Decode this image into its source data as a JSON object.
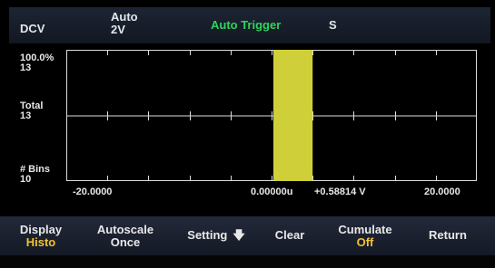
{
  "status": {
    "mode": "DCV",
    "range_top": "Auto",
    "range_bottom": "2V",
    "trigger": "Auto Trigger",
    "s_indicator": "S"
  },
  "left_labels": {
    "top_pct": "100.0%",
    "top_count": "13",
    "total_label": "Total",
    "total_value": "13",
    "bins_label": "# Bins",
    "bins_value": "10"
  },
  "x_labels": {
    "left": "-20.0000",
    "mid": "0.00000u",
    "value": "+0.58814 V",
    "right": "20.0000"
  },
  "chart_data": {
    "type": "bar",
    "xlim": [
      -20.0,
      20.0
    ],
    "bin_count": 10,
    "total_count": 13,
    "bars": [
      {
        "x_start": 0.0,
        "x_end": 4.0,
        "count": 13,
        "percent": 100.0
      }
    ],
    "bar_color": "#cfcf3a"
  },
  "softkeys": {
    "display": {
      "label": "Display",
      "value": "Histo"
    },
    "autoscale": {
      "label": "Autoscale",
      "value": "Once"
    },
    "setting": {
      "label": "Setting",
      "icon": "arrow-down-icon"
    },
    "clear": {
      "label": "Clear"
    },
    "cumulate": {
      "label": "Cumulate",
      "value": "Off"
    },
    "return": {
      "label": "Return"
    }
  }
}
